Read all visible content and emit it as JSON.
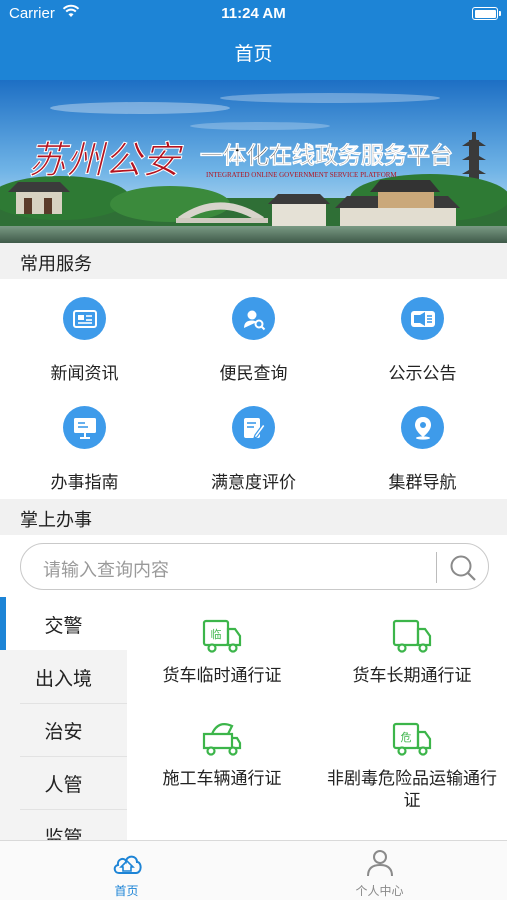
{
  "status_bar": {
    "carrier": "Carrier",
    "time": "11:24 AM"
  },
  "nav": {
    "title": "首页"
  },
  "banner": {
    "title_script": "苏州公安",
    "headline": "一体化在线政务服务平台",
    "subtitle": "INTEGRATED ONLINE GOVERNMENT SERVICE PLATFORM"
  },
  "common_services": {
    "header": "常用服务",
    "items": [
      {
        "label": "新闻资讯",
        "icon": "newspaper-icon"
      },
      {
        "label": "便民查询",
        "icon": "user-search-icon"
      },
      {
        "label": "公示公告",
        "icon": "announcement-icon"
      },
      {
        "label": "办事指南",
        "icon": "guide-board-icon"
      },
      {
        "label": "满意度评价",
        "icon": "evaluation-icon"
      },
      {
        "label": "集群导航",
        "icon": "location-pin-icon"
      }
    ]
  },
  "handheld": {
    "header": "掌上办事",
    "search_placeholder": "请输入查询内容",
    "categories": [
      {
        "label": "交警",
        "active": true
      },
      {
        "label": "出入境",
        "active": false
      },
      {
        "label": "治安",
        "active": false
      },
      {
        "label": "人管",
        "active": false
      },
      {
        "label": "监管",
        "active": false
      }
    ],
    "permits": [
      {
        "label": "货车临时通行证",
        "badge": "临",
        "icon": "truck-temporary-icon"
      },
      {
        "label": "货车长期通行证",
        "badge": "",
        "icon": "truck-long-term-icon"
      },
      {
        "label": "施工车辆通行证",
        "badge": "",
        "icon": "construction-truck-icon"
      },
      {
        "label": "非剧毒危险品运输通行证",
        "badge": "危",
        "icon": "hazard-truck-icon"
      }
    ]
  },
  "tab_bar": {
    "tabs": [
      {
        "label": "首页",
        "active": true,
        "icon": "home-cloud-icon"
      },
      {
        "label": "个人中心",
        "active": false,
        "icon": "person-icon"
      }
    ]
  },
  "colors": {
    "primary": "#1d84d6",
    "icon_blue": "#3e9bea",
    "permit_green": "#3cb54a",
    "section_bg": "#f1f1f1",
    "banner_red": "#b3121f"
  }
}
